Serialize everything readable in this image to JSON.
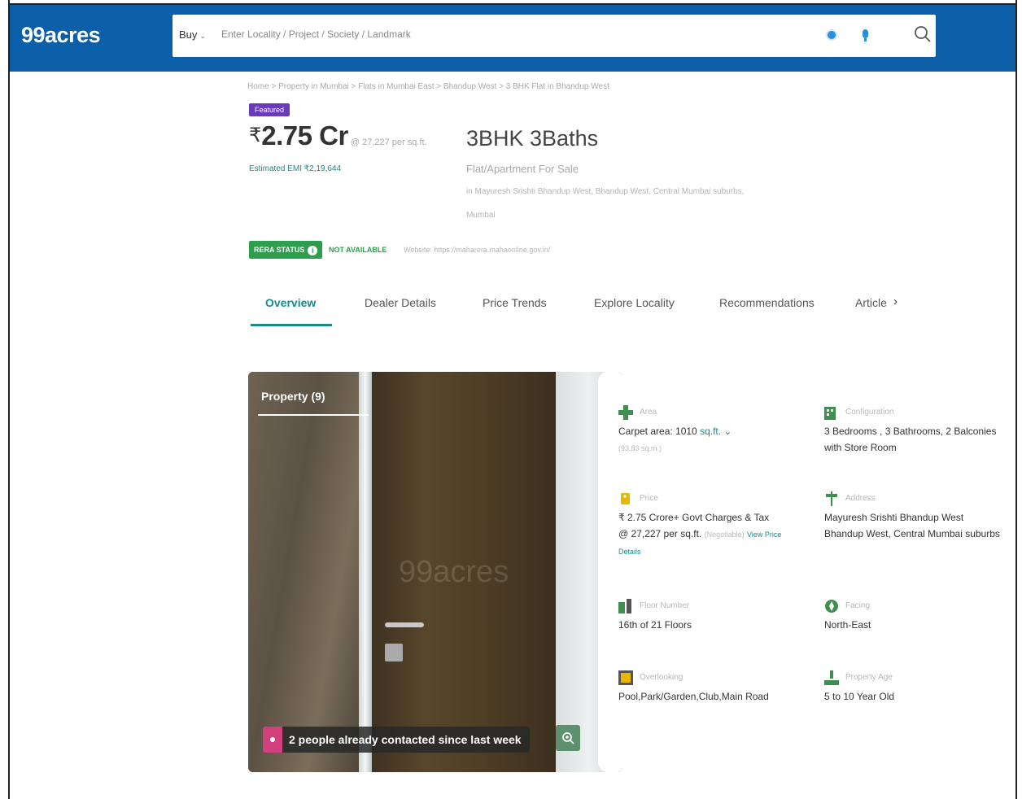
{
  "header": {
    "logo": "99acres",
    "buy_label": "Buy",
    "search_placeholder": "Enter Locality / Project / Society / Landmark"
  },
  "listing": {
    "breadcrumb": "Home > Property in Mumbai > Flats in Mumbai East > Bhandup West > 3 BHK Flat in Bhandup West",
    "featured": "Featured",
    "currency_symbol": "₹",
    "price": "2.75 Cr",
    "price_per_sqft": "@ 27,227 per sq.ft.",
    "emi": "Estimated EMI ₹2,19,644",
    "bhk": "3BHK 3Baths",
    "property_type": "Flat/Apartment For Sale",
    "address_line1": "in Mayuresh Srishti Bhandup West, Bhandup West, Central Mumbai suburbs,",
    "address_line2": "Mumbai",
    "rera_status": "RERA STATUS",
    "rera_info": "i",
    "rera_value": "NOT AVAILABLE",
    "website": "Website: https://maharera.mahaonline.gov.in/"
  },
  "tabs": [
    {
      "label": "Overview"
    },
    {
      "label": "Dealer Details"
    },
    {
      "label": "Price Trends"
    },
    {
      "label": "Explore Locality"
    },
    {
      "label": "Recommendations"
    },
    {
      "label": "Article"
    }
  ],
  "tabs_arrow": "›",
  "photo": {
    "title": "Property (9)",
    "watermark": "99acres",
    "contacted": "2 people already contacted since last week"
  },
  "details": {
    "area": {
      "label": "Area",
      "value": "Carpet area: 1010",
      "unit": "sq.ft.",
      "sub": "(93.83 sq.m.)"
    },
    "configuration": {
      "label": "Configuration",
      "line1": "3 Bedrooms , 3 Bathrooms, 2 Balconies",
      "line2": "with Store Room"
    },
    "price": {
      "label": "Price",
      "line1": "₹ 2.75 Crore+ Govt Charges & Tax",
      "line2": "@ 27,227 per sq.ft.",
      "negotiable": "(Negotiable)",
      "view_link": "View Price",
      "details_link": "Details"
    },
    "address": {
      "label": "Address",
      "line1": "Mayuresh Srishti Bhandup West",
      "line2": "Bhandup West, Central Mumbai suburbs"
    },
    "floor": {
      "label": "Floor Number",
      "value": "16th  of 21 Floors"
    },
    "facing": {
      "label": "Facing",
      "value": "North-East"
    },
    "overlooking": {
      "label": "Overlooking",
      "value": "Pool,Park/Garden,Club,Main Road"
    },
    "age": {
      "label": "Property Age",
      "value": "5 to 10 Year Old"
    }
  },
  "colors": {
    "header_bg": "#0b5ea8",
    "accent_teal": "#1a8a8a",
    "rera_green": "#2e9e4e",
    "featured_purple": "#6a3ab8"
  }
}
